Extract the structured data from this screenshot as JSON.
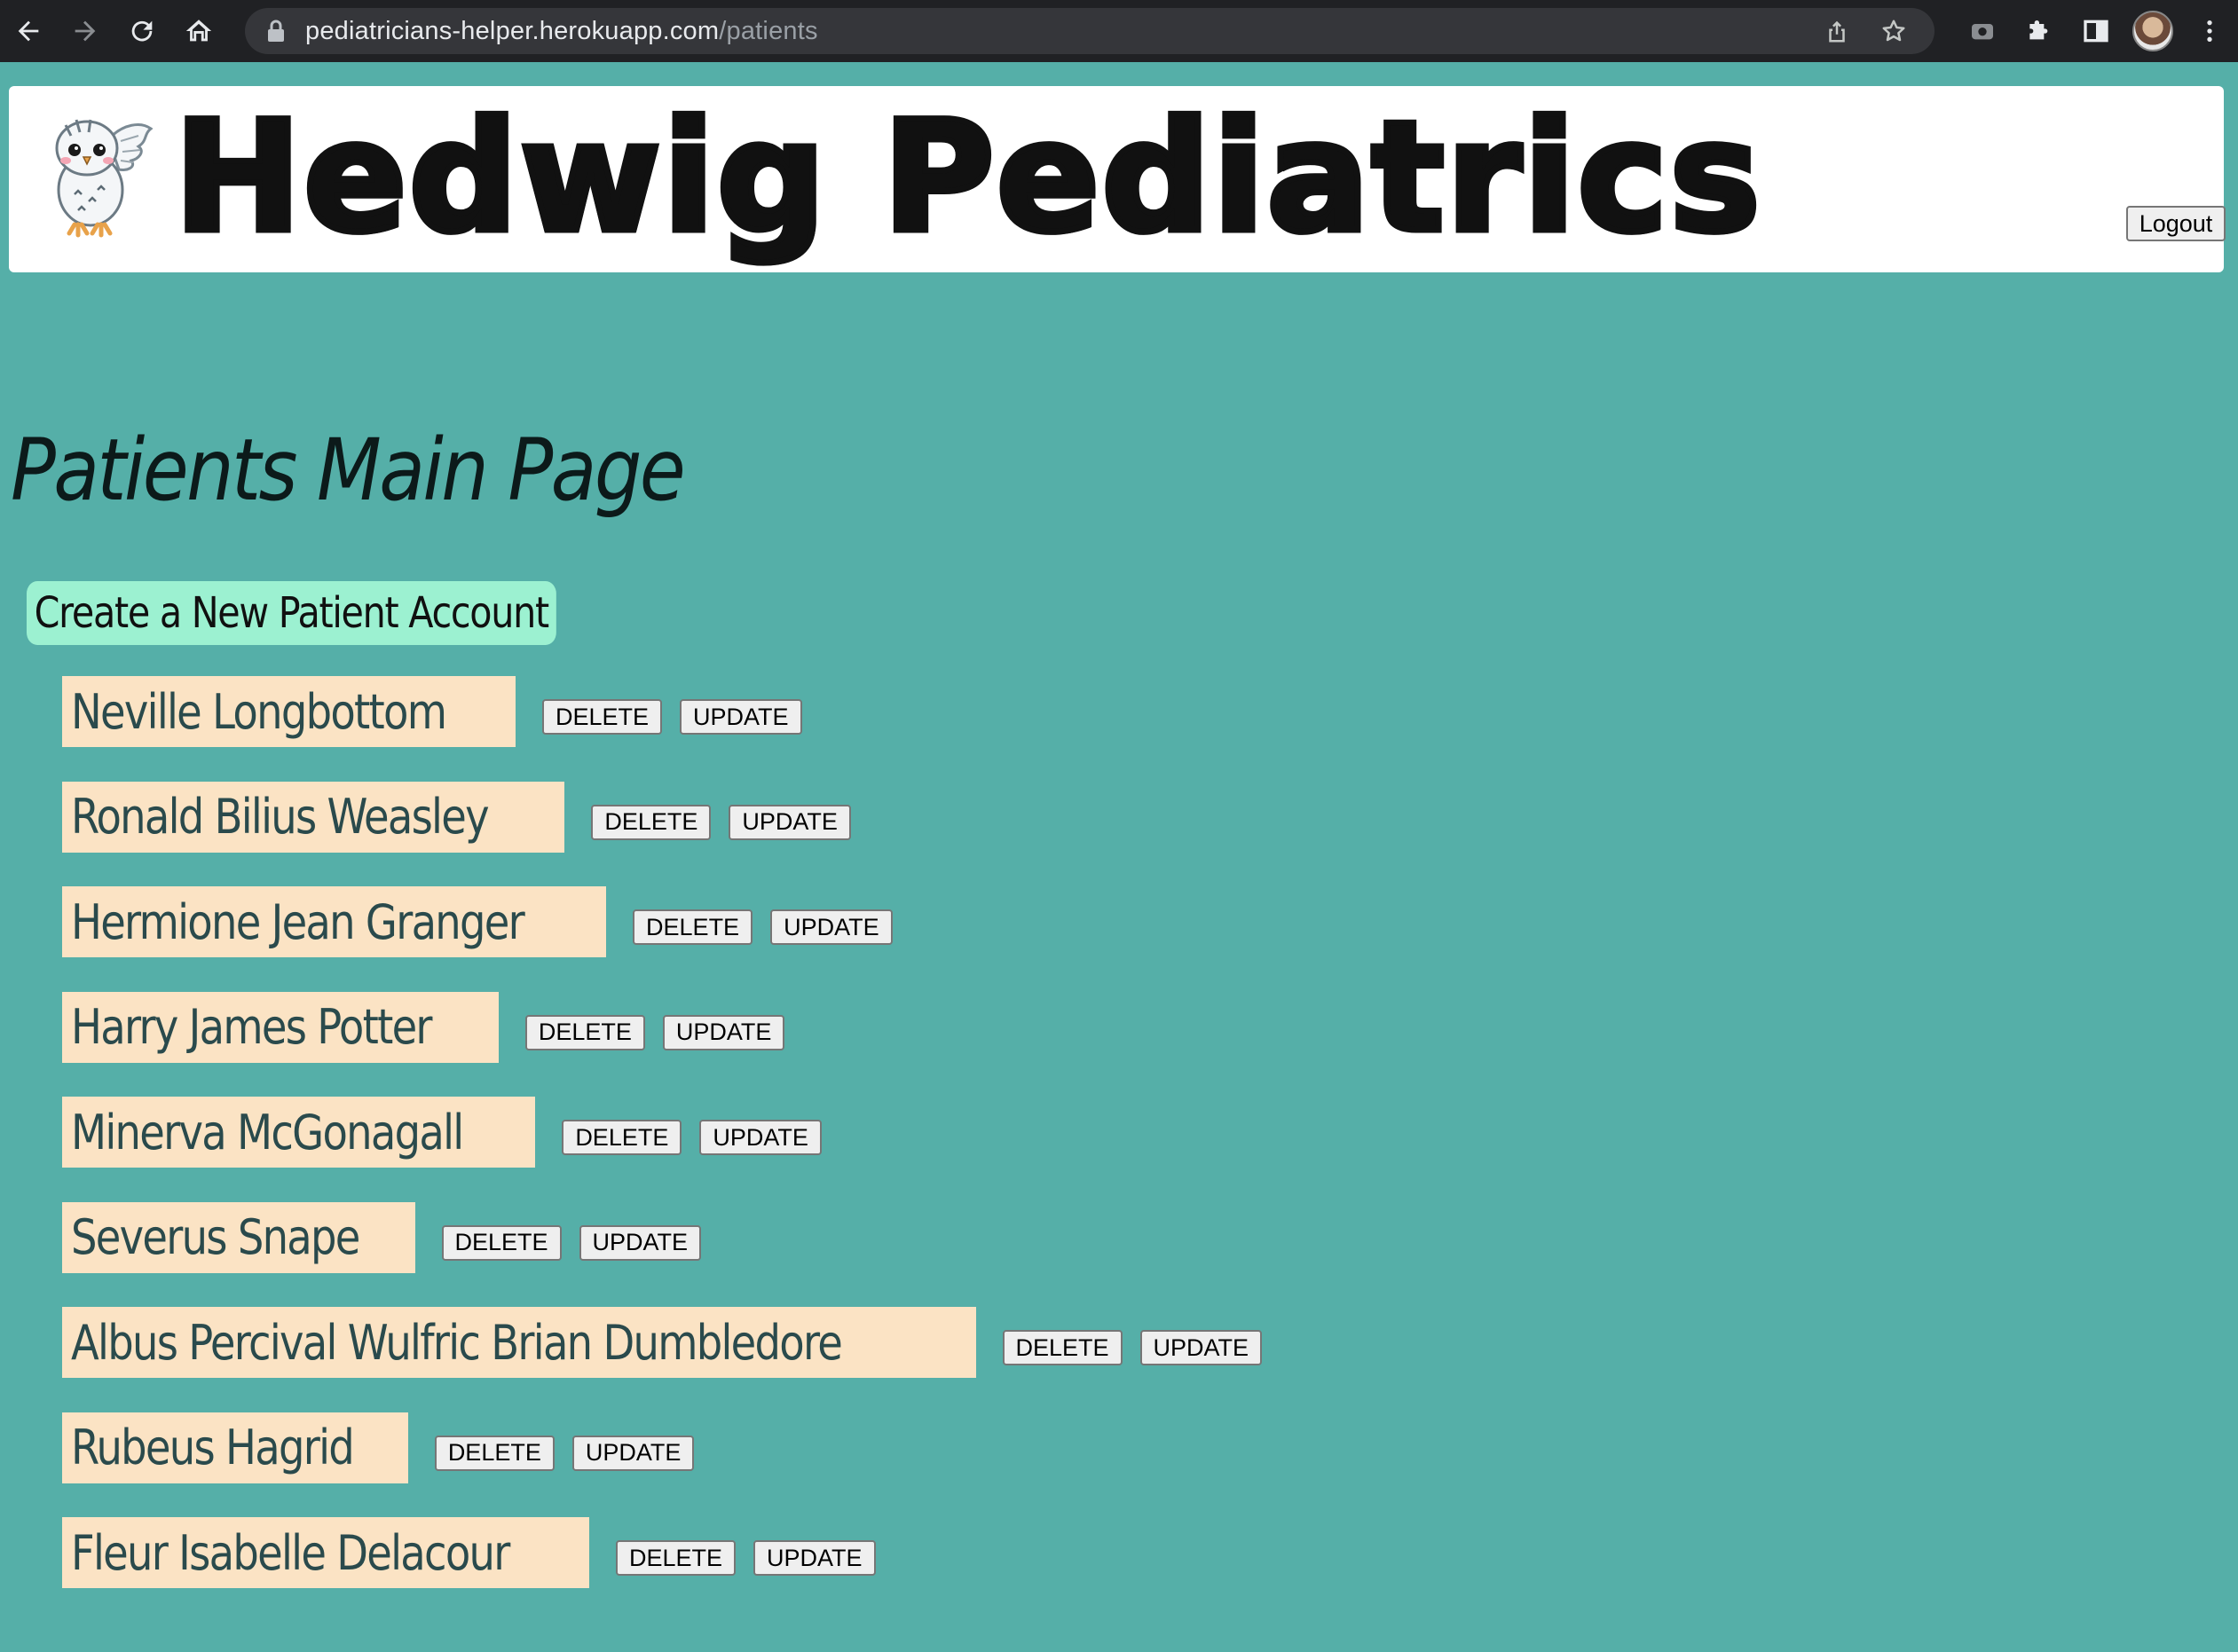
{
  "browser": {
    "url_host": "pediatricians-helper.herokuapp.com",
    "url_path": "/patients"
  },
  "header": {
    "brand_title": "Hedwig Pediatrics",
    "logout_label": "Logout"
  },
  "main": {
    "page_title": "Patients Main Page",
    "create_label": "Create a New Patient Account",
    "delete_label": "DELETE",
    "update_label": "UPDATE",
    "patients": [
      {
        "name": "Neville Longbottom",
        "delete": "DELETE",
        "update": "UPDATE"
      },
      {
        "name": "Ronald Bilius Weasley",
        "delete": "DELETE",
        "update": "UPDATE"
      },
      {
        "name": "Hermione Jean Granger",
        "delete": "DELETE",
        "update": "UPDATE"
      },
      {
        "name": "Harry James Potter",
        "delete": "DELETE",
        "update": "UPDATE"
      },
      {
        "name": "Minerva McGonagall",
        "delete": "DELETE",
        "update": "UPDATE"
      },
      {
        "name": "Severus Snape",
        "delete": "DELETE",
        "update": "UPDATE"
      },
      {
        "name": "Albus Percival Wulfric Brian Dumbledore",
        "delete": "DELETE",
        "update": "UPDATE"
      },
      {
        "name": "Rubeus Hagrid",
        "delete": "DELETE",
        "update": "UPDATE"
      },
      {
        "name": "Fleur Isabelle Delacour",
        "delete": "DELETE",
        "update": "UPDATE"
      }
    ]
  },
  "colors": {
    "page_background": "#55afa8",
    "create_button": "#9cf1d1",
    "patient_chip": "#fbe3c4",
    "patient_text": "#2a4a4c"
  },
  "icons": {
    "back": "arrow-left-icon",
    "forward": "arrow-right-icon",
    "reload": "reload-icon",
    "home": "home-icon",
    "lock": "lock-icon",
    "share": "share-icon",
    "bookmark": "star-icon",
    "screenshot": "camera-icon",
    "extensions": "puzzle-icon",
    "sidepanel": "side-panel-icon",
    "menu": "kebab-menu-icon",
    "logo": "owl-logo"
  }
}
